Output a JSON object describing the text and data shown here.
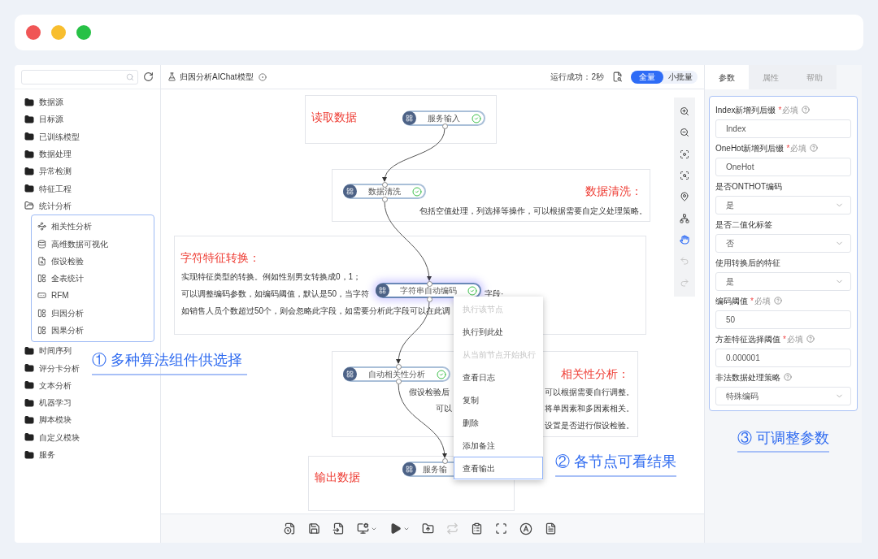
{
  "sidebar": {
    "items": [
      {
        "label": "数据源",
        "expanded": false
      },
      {
        "label": "目标源",
        "expanded": false
      },
      {
        "label": "已训练模型",
        "expanded": false
      },
      {
        "label": "数据处理",
        "expanded": false
      },
      {
        "label": "异常检测",
        "expanded": false
      },
      {
        "label": "特征工程",
        "expanded": false
      },
      {
        "label": "统计分析",
        "expanded": true,
        "children": [
          {
            "label": "相关性分析"
          },
          {
            "label": "高维数据可视化"
          },
          {
            "label": "假设检验"
          },
          {
            "label": "全表统计"
          },
          {
            "label": "RFM"
          },
          {
            "label": "归因分析"
          },
          {
            "label": "因果分析"
          }
        ]
      },
      {
        "label": "时间序列",
        "expanded": false
      },
      {
        "label": "评分卡分析",
        "expanded": false
      },
      {
        "label": "文本分析",
        "expanded": false
      },
      {
        "label": "机器学习",
        "expanded": false
      },
      {
        "label": "脚本模块",
        "expanded": false
      },
      {
        "label": "自定义模块",
        "expanded": false
      },
      {
        "label": "服务",
        "expanded": false
      }
    ]
  },
  "header": {
    "title": "归因分析AIChat模型",
    "status": "运行成功：2秒",
    "modes": [
      {
        "label": "全量",
        "selected": true
      },
      {
        "label": "小批量",
        "selected": false
      }
    ]
  },
  "notes": [
    {
      "title": "读取数据"
    },
    {
      "title": "数据清洗：",
      "lines": [
        "包括空值处理，列选择等操作，可以根据需要自定义处理策略。"
      ]
    },
    {
      "title": "字符特征转换：",
      "lines": [
        "实现特征类型的转换。例如性别男女转换成0，1；",
        "可以调整编码参数，如编码阈值，默认是50，当字符",
        "字段·",
        "如销售人员个数超过50个，则会忽略此字段，如需要分析此字段可以在此调"
      ]
    },
    {
      "title": "相关性分析：",
      "lines": [
        "假设检验后",
        "可以",
        "可以根据需要自行调整。",
        "将单因素和多因素相关。",
        "设置是否进行假设检验。"
      ]
    },
    {
      "title": "输出数据"
    }
  ],
  "nodes": [
    {
      "label": "服务输入",
      "ok": true,
      "selected": false
    },
    {
      "label": "数据清洗",
      "ok": true,
      "selected": false
    },
    {
      "label": "字符串自动编码",
      "ok": true,
      "selected": true
    },
    {
      "label": "自动相关性分析",
      "ok": true,
      "selected": false
    },
    {
      "label": "服务输",
      "ok": false,
      "selected": false
    }
  ],
  "context_menu": {
    "items": [
      {
        "label": "执行该节点",
        "disabled": true,
        "selected": false
      },
      {
        "label": "执行到此处",
        "disabled": false,
        "selected": false
      },
      {
        "label": "从当前节点开始执行",
        "disabled": true,
        "selected": false
      },
      {
        "label": "查看日志",
        "disabled": false,
        "selected": false
      },
      {
        "label": "复制",
        "disabled": false,
        "selected": false
      },
      {
        "label": "删除",
        "disabled": false,
        "selected": false
      },
      {
        "label": "添加备注",
        "disabled": false,
        "selected": false
      },
      {
        "label": "查看输出",
        "disabled": false,
        "selected": true
      }
    ]
  },
  "canvas_tools": [
    {
      "selected": false,
      "disabled": false
    },
    {
      "selected": false,
      "disabled": false
    },
    {
      "selected": false,
      "disabled": false
    },
    {
      "selected": false,
      "disabled": false
    },
    {
      "selected": false,
      "disabled": false
    },
    {
      "selected": false,
      "disabled": false
    },
    {
      "selected": true,
      "disabled": false
    },
    {
      "selected": false,
      "disabled": true
    },
    {
      "selected": false,
      "disabled": true
    }
  ],
  "toolbar_buttons": [
    {
      "disabled": false
    },
    {
      "disabled": false
    },
    {
      "disabled": false
    },
    {
      "disabled": false
    },
    {
      "disabled": false
    },
    {
      "disabled": false
    },
    {
      "disabled": true
    },
    {
      "disabled": false
    },
    {
      "disabled": false
    },
    {
      "disabled": false
    },
    {
      "disabled": false
    }
  ],
  "panel": {
    "tabs": [
      {
        "label": "参数",
        "selected": true
      },
      {
        "label": "属性",
        "selected": false
      },
      {
        "label": "帮助",
        "selected": false
      }
    ],
    "fields": [
      {
        "label": "Index新增列后缀",
        "required_mark": "*",
        "required": "必填",
        "help": true,
        "kind": "input",
        "value": "Index"
      },
      {
        "label": "OneHot新增列后缀",
        "required_mark": "*",
        "required": "必填",
        "help": true,
        "kind": "input",
        "value": "OneHot"
      },
      {
        "label": "是否ONTHOT编码",
        "help": false,
        "kind": "select",
        "value": "是"
      },
      {
        "label": "是否二值化标签",
        "help": false,
        "kind": "select",
        "value": "否"
      },
      {
        "label": "使用转换后的特征",
        "help": false,
        "kind": "select",
        "value": "是"
      },
      {
        "label": "编码阈值",
        "required_mark": "*",
        "required": "必填",
        "help": true,
        "kind": "input",
        "value": "50"
      },
      {
        "label": "方差特征选择阈值",
        "required_mark": "*",
        "required": "必填",
        "help": true,
        "kind": "input",
        "value": "0.000001"
      },
      {
        "label": "非法数据处理策略",
        "help": true,
        "kind": "select",
        "value": "特殊编码"
      }
    ]
  },
  "callouts": [
    "① 多种算法组件供选择",
    "② 各节点可看结果",
    "③ 可调整参数"
  ]
}
